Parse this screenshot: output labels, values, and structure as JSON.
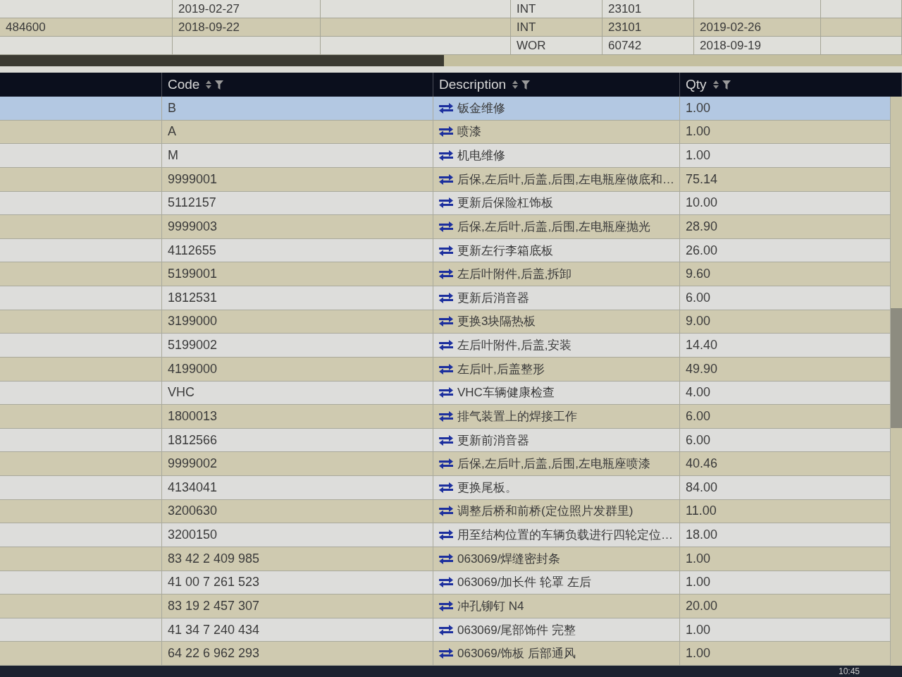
{
  "upper_table": {
    "rows": [
      {
        "cells": {
          "column_2": "2019-02-27",
          "column_4": "INT",
          "column_5": "23101"
        }
      },
      {
        "cells": {
          "column_1": "484600",
          "column_2": "2018-09-22",
          "column_4": "INT",
          "column_5": "23101",
          "column_6": "2019-02-26"
        }
      },
      {
        "cells": {
          "column_4": "WOR",
          "column_5": "60742",
          "column_6": "2018-09-19"
        }
      }
    ]
  },
  "table": {
    "columns": [
      {
        "label": "Code"
      },
      {
        "label": "Description"
      },
      {
        "label": "Qty"
      }
    ],
    "rows": [
      {
        "code": "B",
        "description": "钣金维修",
        "qty": "1.00",
        "selected": true
      },
      {
        "code": "A",
        "description": "喷漆",
        "qty": "1.00",
        "selected": false
      },
      {
        "code": "M",
        "description": "机电维修",
        "qty": "1.00",
        "selected": false
      },
      {
        "code": "9999001",
        "description": "后保,左后叶,后盖,后围,左电瓶座做底和…",
        "qty": "75.14",
        "selected": false
      },
      {
        "code": "5112157",
        "description": "更新后保险杠饰板",
        "qty": "10.00",
        "selected": false
      },
      {
        "code": "9999003",
        "description": "后保,左后叶,后盖,后围,左电瓶座抛光",
        "qty": "28.90",
        "selected": false
      },
      {
        "code": "4112655",
        "description": "更新左行李箱底板",
        "qty": "26.00",
        "selected": false
      },
      {
        "code": "5199001",
        "description": "左后叶附件,后盖,拆卸",
        "qty": "9.60",
        "selected": false
      },
      {
        "code": "1812531",
        "description": "更新后消音器",
        "qty": "6.00",
        "selected": false
      },
      {
        "code": "3199000",
        "description": "更换3块隔热板",
        "qty": "9.00",
        "selected": false
      },
      {
        "code": "5199002",
        "description": "左后叶附件,后盖,安装",
        "qty": "14.40",
        "selected": false
      },
      {
        "code": "4199000",
        "description": "左后叶,后盖整形",
        "qty": "49.90",
        "selected": false
      },
      {
        "code": "VHC",
        "description": "VHC车辆健康检查",
        "qty": "4.00",
        "selected": false
      },
      {
        "code": "1800013",
        "description": "排气装置上的焊接工作",
        "qty": "6.00",
        "selected": false
      },
      {
        "code": "1812566",
        "description": "更新前消音器",
        "qty": "6.00",
        "selected": false
      },
      {
        "code": "9999002",
        "description": "后保,左后叶,后盖,后围,左电瓶座喷漆",
        "qty": "40.46",
        "selected": false
      },
      {
        "code": "4134041",
        "description": "更换尾板。",
        "qty": "84.00",
        "selected": false
      },
      {
        "code": "3200630",
        "description": "调整后桥和前桥(定位照片发群里)",
        "qty": "11.00",
        "selected": false
      },
      {
        "code": "3200150",
        "description": "用至结构位置的车辆负载进行四轮定位…",
        "qty": "18.00",
        "selected": false
      },
      {
        "code": "83 42 2 409 985",
        "description": "063069/焊缝密封条",
        "qty": "1.00",
        "selected": false
      },
      {
        "code": "41 00 7 261 523",
        "description": "063069/加长件 轮罩 左后",
        "qty": "1.00",
        "selected": false
      },
      {
        "code": "83 19 2 457 307",
        "description": "冲孔铆钉 N4",
        "qty": "20.00",
        "selected": false
      },
      {
        "code": "41 34 7 240 434",
        "description": "063069/尾部饰件 完整",
        "qty": "1.00",
        "selected": false
      },
      {
        "code": "64 22 6 962 293",
        "description": "063069/饰板 后部通风",
        "qty": "1.00",
        "selected": false
      }
    ]
  },
  "taskbar": {
    "clock": "10:45"
  }
}
